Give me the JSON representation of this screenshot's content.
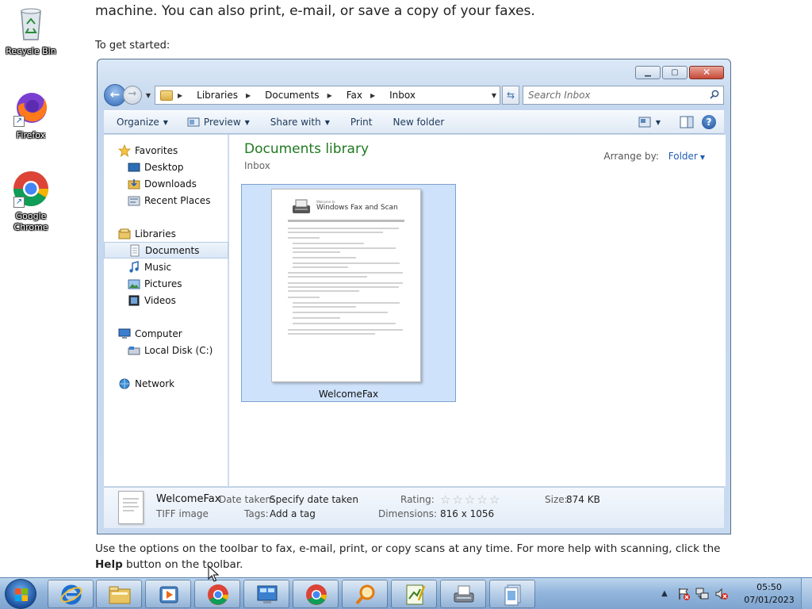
{
  "desktop": {
    "icons": [
      {
        "label": "Recycle Bin",
        "icon": "recycle-bin-icon"
      },
      {
        "label": "Firefox",
        "icon": "firefox-icon"
      },
      {
        "label": "Google Chrome",
        "icon": "chrome-icon"
      }
    ]
  },
  "document": {
    "top_line": "machine. You can also print, e-mail, or save a copy of your faxes.",
    "get_started": "To get started:",
    "bottom_line1": "Use the options on the toolbar to fax, e-mail, print, or copy scans at any time. For more help with scanning, click the",
    "bottom_help": "Help",
    "bottom_line2_rest": " button on the toolbar."
  },
  "explorer": {
    "address": {
      "crumbs": [
        "Libraries",
        "Documents",
        "Fax",
        "Inbox"
      ]
    },
    "search": {
      "placeholder": "Search Inbox"
    },
    "toolbar": {
      "organize": "Organize",
      "preview": "Preview",
      "share_with": "Share with",
      "print": "Print",
      "new_folder": "New folder"
    },
    "nav": {
      "favorites": "Favorites",
      "desktop": "Desktop",
      "downloads": "Downloads",
      "recent_places": "Recent Places",
      "libraries": "Libraries",
      "documents": "Documents",
      "music": "Music",
      "pictures": "Pictures",
      "videos": "Videos",
      "computer": "Computer",
      "local_disk": "Local Disk (C:)",
      "network": "Network"
    },
    "content": {
      "title": "Documents library",
      "subtitle": "Inbox",
      "arrange_label": "Arrange by:",
      "arrange_value": "Folder",
      "file": {
        "name": "WelcomeFax",
        "thumb_small": "Welcome to",
        "thumb_title": "Windows Fax and Scan"
      }
    },
    "details": {
      "name": "WelcomeFax",
      "type": "TIFF image",
      "date_taken_label": "Date taken:",
      "date_taken_value": "Specify date taken",
      "tags_label": "Tags:",
      "tags_value": "Add a tag",
      "rating_label": "Rating:",
      "rating_stars": 0,
      "dimensions_label": "Dimensions:",
      "dimensions_value": "816 x 1056",
      "size_label": "Size:",
      "size_value": "874 KB"
    }
  },
  "taskbar": {
    "apps": [
      "internet-explorer",
      "windows-explorer",
      "media-player",
      "chrome",
      "control-panel",
      "chrome",
      "search-magnifier",
      "notepad-editor",
      "fax-and-scan",
      "documents"
    ],
    "clock_time": "05:50",
    "clock_date": "07/01/2023"
  }
}
